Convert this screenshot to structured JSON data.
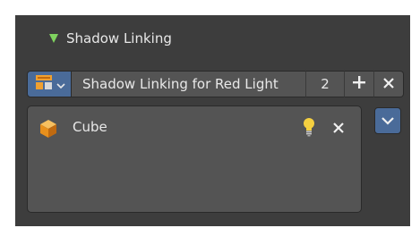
{
  "panel": {
    "title": "Shadow Linking",
    "expanded_icon": "disclosure-triangle-down-icon"
  },
  "collection": {
    "browse_icon": "collection-browse-icon",
    "name": "Shadow Linking for Red Light",
    "users": "2",
    "add_icon": "plus-icon",
    "unlink_icon": "close-icon"
  },
  "list": {
    "items": [
      {
        "label": "Cube",
        "icon": "cube-object-icon",
        "state_icon": "light-bulb-icon",
        "remove_icon": "close-icon"
      }
    ]
  },
  "side_controls": {
    "menu_icon": "chevron-down-icon"
  },
  "colors": {
    "panel_bg": "#3d3d3d",
    "field_bg": "#545454",
    "accent_blue": "#4a6b99",
    "disclosure_green": "#7fd35f",
    "cube_orange": "#f0a030",
    "bulb_yellow": "#f5d040"
  }
}
